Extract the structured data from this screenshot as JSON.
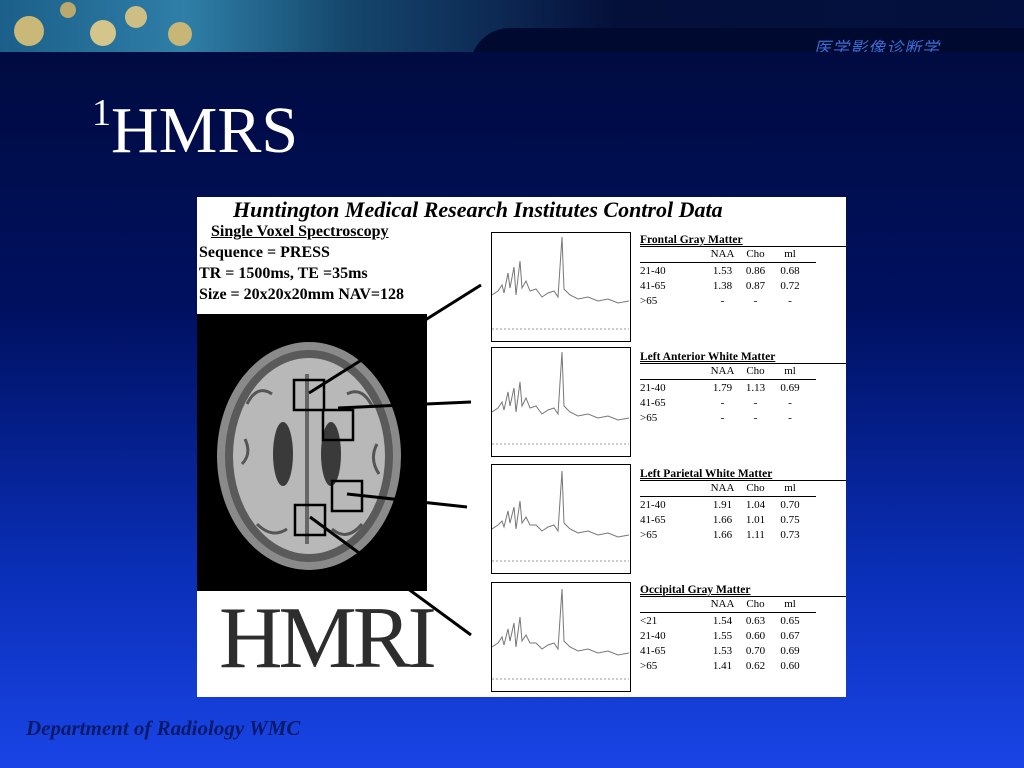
{
  "header": {
    "subtitle": "医学影像诊断学"
  },
  "slide": {
    "title_sup": "1",
    "title_main": "HMRS"
  },
  "figure": {
    "title": "Huntington Medical Research Institutes Control Data",
    "subtitle": "Single Voxel Spectroscopy",
    "params": [
      "Sequence = PRESS",
      "TR = 1500ms, TE =35ms",
      "Size = 20x20x20mm NAV=128"
    ],
    "logo": "HMRI",
    "column_headers": [
      "",
      "NAA",
      "Cho",
      "ml"
    ],
    "regions": [
      {
        "name": "Frontal Gray Matter",
        "rows": [
          [
            "21-40",
            "1.53",
            "0.86",
            "0.68"
          ],
          [
            "41-65",
            "1.38",
            "0.87",
            "0.72"
          ],
          [
            ">65",
            "-",
            "-",
            "-"
          ]
        ]
      },
      {
        "name": "Left Anterior White Matter",
        "rows": [
          [
            "21-40",
            "1.79",
            "1.13",
            "0.69"
          ],
          [
            "41-65",
            "-",
            "-",
            "-"
          ],
          [
            ">65",
            "-",
            "-",
            "-"
          ]
        ]
      },
      {
        "name": "Left Parietal White Matter",
        "rows": [
          [
            "21-40",
            "1.91",
            "1.04",
            "0.70"
          ],
          [
            "41-65",
            "1.66",
            "1.01",
            "0.75"
          ],
          [
            ">65",
            "1.66",
            "1.11",
            "0.73"
          ]
        ]
      },
      {
        "name": "Occipital Gray Matter",
        "rows": [
          [
            "<21",
            "1.54",
            "0.63",
            "0.65"
          ],
          [
            "21-40",
            "1.55",
            "0.60",
            "0.67"
          ],
          [
            "41-65",
            "1.53",
            "0.70",
            "0.69"
          ],
          [
            ">65",
            "1.41",
            "0.62",
            "0.60"
          ]
        ]
      }
    ]
  },
  "footer": {
    "text": "Department of Radiology WMC"
  },
  "colors": {
    "background_top": "#000a3a",
    "background_bottom": "#1a45e6",
    "footer": "#0a1a6a",
    "title": "#ffffff"
  }
}
